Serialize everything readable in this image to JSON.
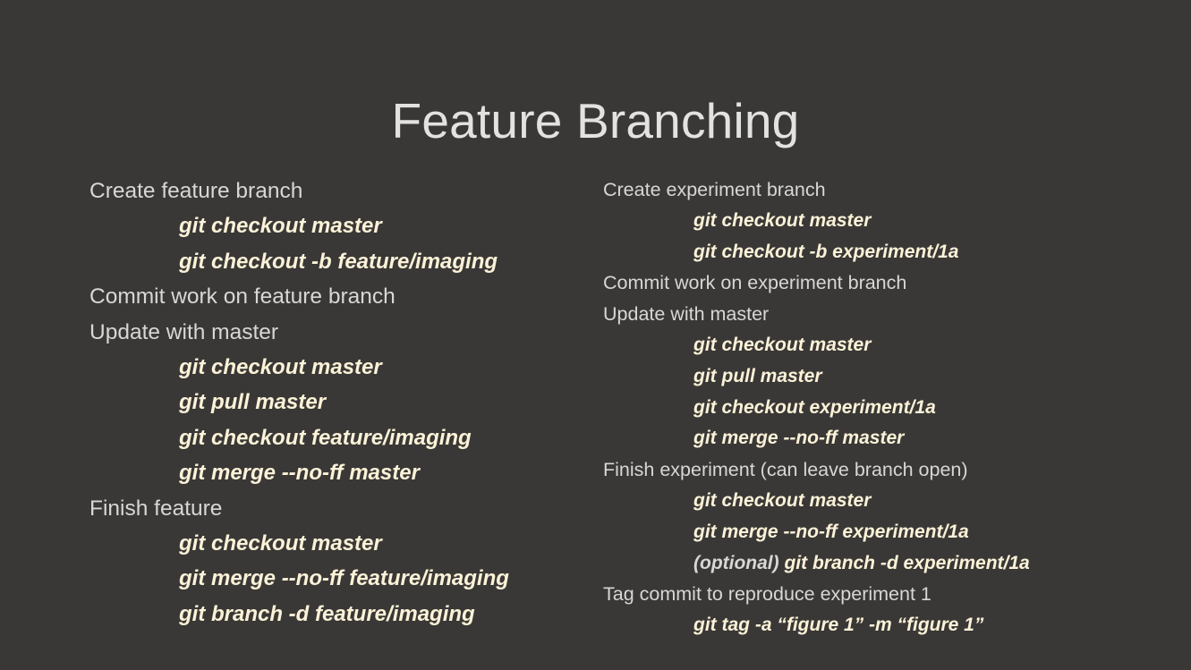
{
  "slide": {
    "title": "Feature Branching",
    "background_color": "#3a3836",
    "heading_color": "#d7d7d5",
    "command_color": "#fbf2d8",
    "title_color": "#e2e2e0"
  },
  "left_column": {
    "lines": [
      {
        "level": 0,
        "text": "Create feature branch"
      },
      {
        "level": 1,
        "text": "git checkout master"
      },
      {
        "level": 1,
        "text": "git checkout -b feature/imaging"
      },
      {
        "level": 0,
        "text": "Commit work on feature branch"
      },
      {
        "level": 0,
        "text": "Update with master"
      },
      {
        "level": 1,
        "text": "git checkout master"
      },
      {
        "level": 1,
        "text": "git pull master"
      },
      {
        "level": 1,
        "text": "git checkout feature/imaging"
      },
      {
        "level": 1,
        "text": "git merge --no-ff master"
      },
      {
        "level": 0,
        "text": "Finish feature"
      },
      {
        "level": 1,
        "text": "git checkout master"
      },
      {
        "level": 1,
        "text": "git merge --no-ff feature/imaging"
      },
      {
        "level": 1,
        "text": "git branch -d feature/imaging"
      }
    ]
  },
  "right_column": {
    "lines": [
      {
        "level": 0,
        "text": "Create experiment branch"
      },
      {
        "level": 1,
        "text": "git checkout master"
      },
      {
        "level": 1,
        "text": "git checkout -b experiment/1a"
      },
      {
        "level": 0,
        "text": "Commit work on experiment branch"
      },
      {
        "level": 0,
        "text": "Update with master"
      },
      {
        "level": 1,
        "text": "git checkout master"
      },
      {
        "level": 1,
        "text": "git pull master"
      },
      {
        "level": 1,
        "text": "git checkout experiment/1a"
      },
      {
        "level": 1,
        "text": "git merge --no-ff master"
      },
      {
        "level": 0,
        "text": "Finish experiment (can leave branch open)"
      },
      {
        "level": 1,
        "text": "git checkout master"
      },
      {
        "level": 1,
        "text": "git merge --no-ff experiment/1a"
      },
      {
        "level": 1,
        "prefix": "(optional) ",
        "text": "git branch -d experiment/1a"
      },
      {
        "level": 0,
        "text": "Tag commit to reproduce experiment 1"
      },
      {
        "level": 1,
        "text": "git tag -a “figure 1” -m “figure 1”"
      }
    ]
  }
}
